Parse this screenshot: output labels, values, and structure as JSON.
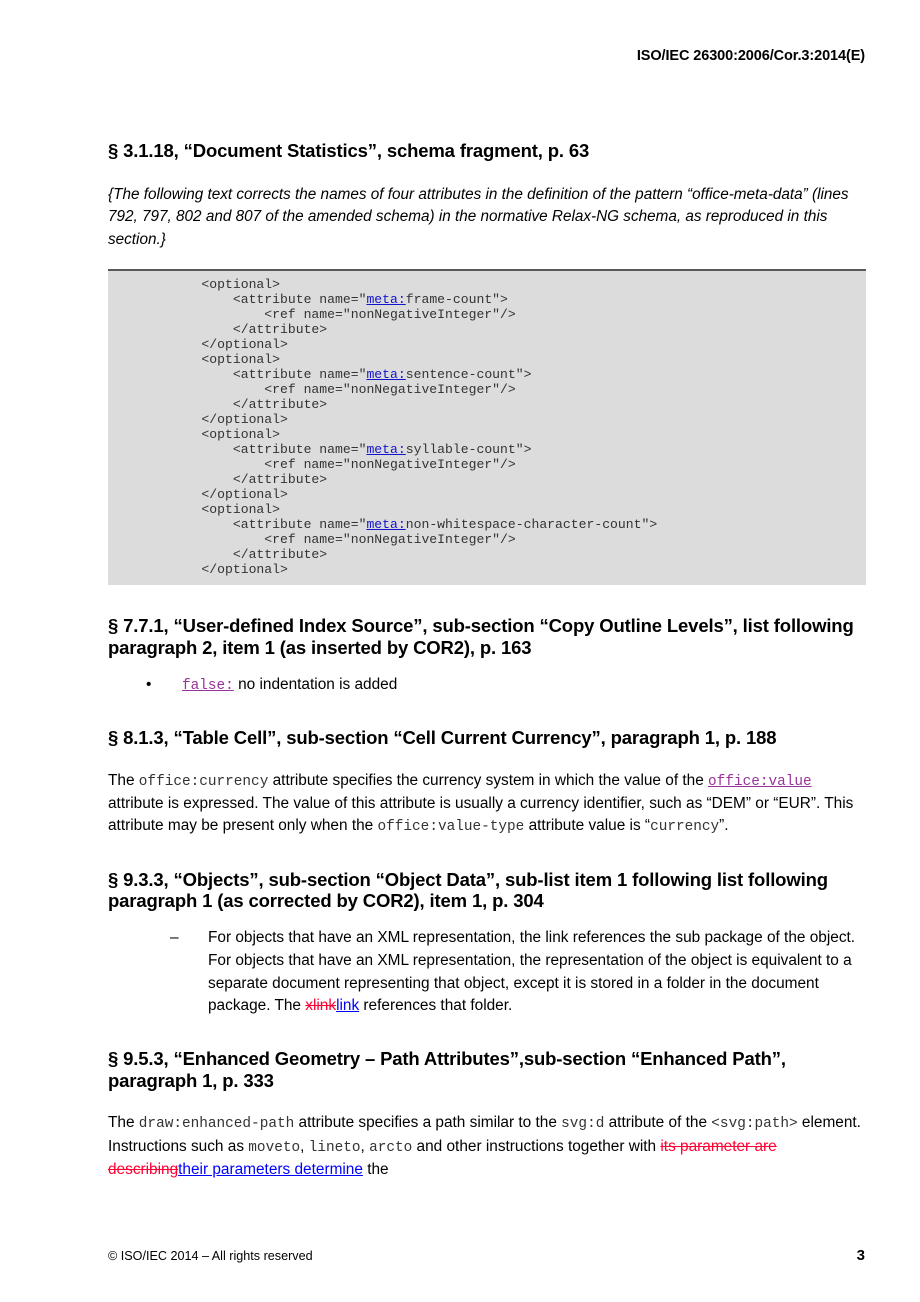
{
  "header": {
    "doc_id": "ISO/IEC 26300:2006/Cor.3:2014(E)"
  },
  "sections": {
    "s1": {
      "heading": "§ 3.1.18, “Document Statistics”, schema fragment, p. 63",
      "note": "{The following text corrects the names of four attributes in the definition of the pattern “office-meta-data” (lines 792, 797, 802 and 807 of the amended schema) in the normative Relax-NG schema, as reproduced in this section.}",
      "code_lines": [
        "    <optional>",
        "        <attribute name=\"meta:frame-count\">",
        "            <ref name=\"nonNegativeInteger\"/>",
        "        </attribute>",
        "    </optional>",
        "    <optional>",
        "        <attribute name=\"meta:sentence-count\">",
        "            <ref name=\"nonNegativeInteger\"/>",
        "        </attribute>",
        "    </optional>",
        "    <optional>",
        "        <attribute name=\"meta:syllable-count\">",
        "            <ref name=\"nonNegativeInteger\"/>",
        "        </attribute>",
        "    </optional>",
        "    <optional>",
        "        <attribute name=\"meta:non-whitespace-character-count\">",
        "            <ref name=\"nonNegativeInteger\"/>",
        "        </attribute>",
        "    </optional>"
      ],
      "code_link_token": "meta:"
    },
    "s2": {
      "heading": "§ 7.7.1, “User-defined Index Source”, sub-section “Copy Outline Levels”, list following paragraph 2, item 1 (as inserted by COR2), p. 163",
      "bullet_marker": "•",
      "item_link": "false:",
      "item_rest": " no indentation is added"
    },
    "s3": {
      "heading": "§ 8.1.3, “Table Cell”, sub-section “Cell Current Currency”, paragraph 1, p. 188",
      "p_t1": "The ",
      "p_c1": "office:currency",
      "p_t2": " attribute specifies the currency system in which the value of the ",
      "p_link": "office:value",
      "p_t3": " attribute is expressed. The value of this attribute is usually a currency identifier, such as “DEM” or “EUR”. This attribute may be present only when the ",
      "p_c2": "office:value-type",
      "p_t4": " attribute value is “",
      "p_c3": "currency",
      "p_t5": "”."
    },
    "s4": {
      "heading": "§ 9.3.3, “Objects”, sub-section “Object Data”, sub-list item 1 following list following paragraph 1 (as corrected by COR2), item 1, p. 304",
      "dash_marker": "–",
      "item_t1": "For objects that have an XML representation, the link references the sub package of the object.  For objects that have an XML representation, the representation of the object is equivalent to a separate document representing that object, except it is stored in a folder in the document package.  The ",
      "item_del": "xlink",
      "item_ins": "link",
      "item_t2": " references that folder."
    },
    "s5": {
      "heading": "§ 9.5.3, “Enhanced Geometry – Path Attributes”,sub-section “Enhanced Path”, paragraph 1, p. 333",
      "p_t1": "The ",
      "p_c1": "draw:enhanced-path",
      "p_t2": " attribute specifies a path similar to the ",
      "p_c2": "svg:d",
      "p_t3": " attribute of the ",
      "p_c3": "<svg:path>",
      "p_t4": " element. Instructions such as ",
      "p_c4": "moveto",
      "p_t5": ", ",
      "p_c5": "lineto",
      "p_t6": ", ",
      "p_c6": "arcto",
      "p_t7": " and other instructions together with ",
      "p_del": "its parameter are describing",
      "p_ins": "their parameters determine",
      "p_t8": " the"
    }
  },
  "footer": {
    "copyright": "©  ISO/IEC 2014 – All rights reserved",
    "page_number": "3"
  },
  "colors": {
    "deletion": "#ff0033",
    "insertion": "#0000ff",
    "visited_link": "#993399",
    "code_link": "#1414cc",
    "code_background": "#dcdcdc",
    "code_border": "#595959"
  }
}
